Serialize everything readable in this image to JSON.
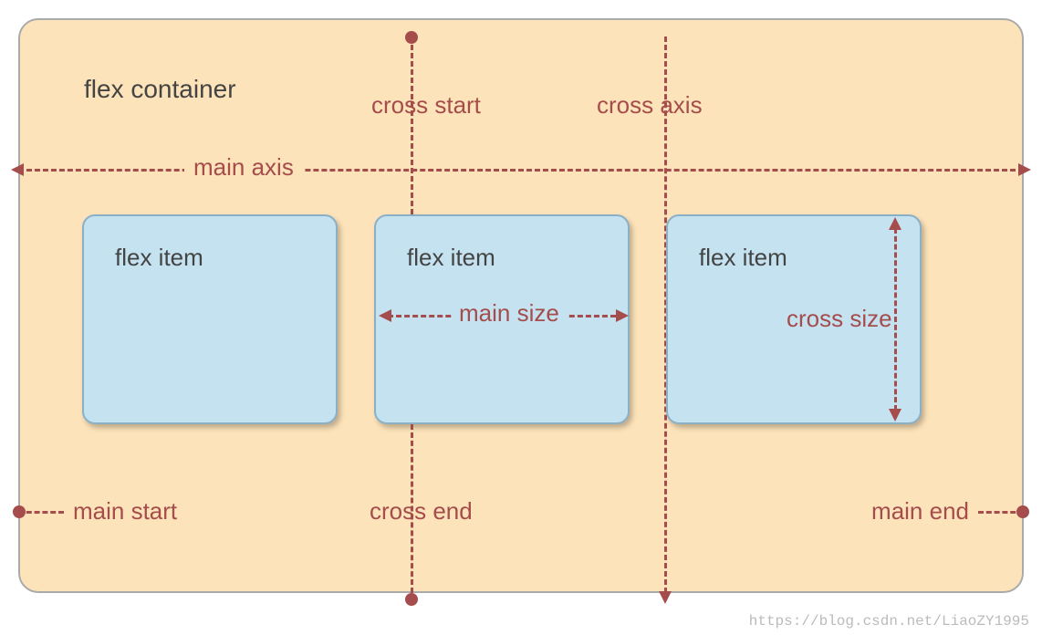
{
  "container": {
    "title": "flex container"
  },
  "items": [
    {
      "label": "flex item"
    },
    {
      "label": "flex item"
    },
    {
      "label": "flex item"
    }
  ],
  "axis": {
    "main_axis": "main axis",
    "cross_axis": "cross axis",
    "cross_start": "cross start",
    "cross_end": "cross end",
    "main_start": "main start",
    "main_end": "main end",
    "main_size": "main size",
    "cross_size": "cross size"
  },
  "colors": {
    "container_bg": "#fde3b9",
    "item_bg": "#c5e2f0",
    "accent": "#a54c4c"
  },
  "watermark": "https://blog.csdn.net/LiaoZY1995"
}
